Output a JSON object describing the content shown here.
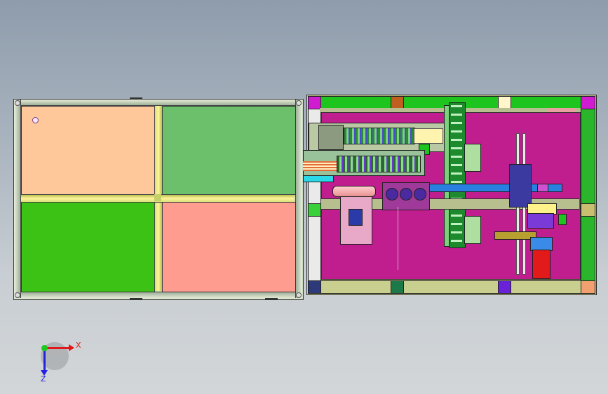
{
  "viewport": {
    "background_top": "#8e9cac",
    "background_bottom": "#d3d6d8"
  },
  "colors": {
    "frame_green": "#1ec51e",
    "base_olive": "#c9cf8e",
    "magenta": "#c01d8f",
    "peach": "#ffc89a",
    "light_green": "#6cc06c",
    "bright_green": "#3bc214",
    "salmon": "#ff9c90"
  },
  "triad": {
    "x_label": "X",
    "z_label": "Z",
    "x_color": "#e0181c",
    "y_color": "#1ec81e",
    "z_color": "#2222e0"
  }
}
